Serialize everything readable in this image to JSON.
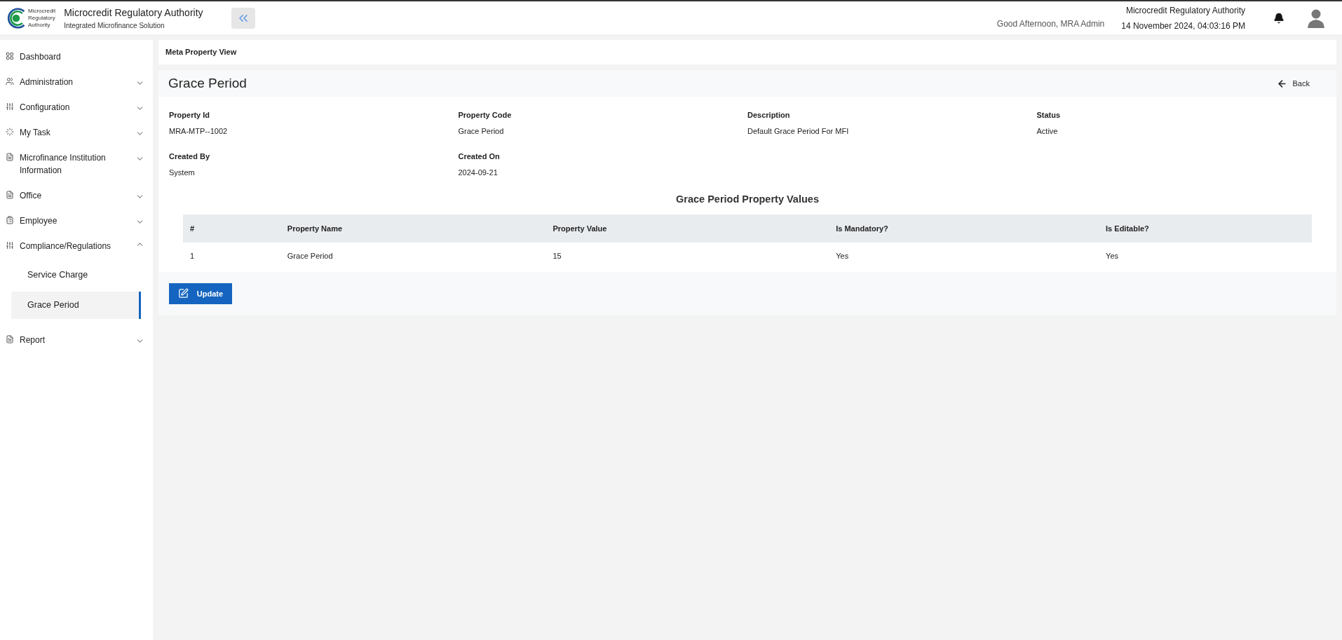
{
  "header": {
    "logo_text": [
      "Microcredit",
      "Regulatory",
      "Authority"
    ],
    "title": "Microcredit Regulatory Authority",
    "subtitle": "Integrated Microfinance Solution",
    "greeting": "Good Afternoon, MRA Admin",
    "org": "Microcredit Regulatory Authority",
    "datetime": "14 November 2024, 04:03:16 PM"
  },
  "sidebar": {
    "items": [
      {
        "kind": "link",
        "label": "Dashboard"
      },
      {
        "kind": "group",
        "label": "Administration",
        "expanded": false
      },
      {
        "kind": "group",
        "label": "Configuration",
        "expanded": false
      },
      {
        "kind": "group",
        "label": "My Task",
        "expanded": false
      },
      {
        "kind": "group",
        "label": "Microfinance Institution Information",
        "expanded": false
      },
      {
        "kind": "group",
        "label": "Office",
        "expanded": false
      },
      {
        "kind": "group",
        "label": "Employee",
        "expanded": false
      },
      {
        "kind": "group",
        "label": "Compliance/Regulations",
        "expanded": true,
        "children": [
          {
            "label": "Service Charge",
            "selected": false
          },
          {
            "label": "Grace Period",
            "selected": true
          }
        ]
      },
      {
        "kind": "group",
        "label": "Report",
        "expanded": false
      }
    ]
  },
  "breadcrumb": "Meta Property View",
  "page": {
    "title": "Grace Period",
    "back": "Back",
    "fields": [
      {
        "label": "Property Id",
        "value": "MRA-MTP--1002"
      },
      {
        "label": "Property Code",
        "value": "Grace Period"
      },
      {
        "label": "Description",
        "value": "Default Grace Period For MFI"
      },
      {
        "label": "Status",
        "value": "Active"
      },
      {
        "label": "Created By",
        "value": "System"
      },
      {
        "label": "Created On",
        "value": "2024-09-21"
      }
    ],
    "table": {
      "title": "Grace Period Property Values",
      "columns": [
        "#",
        "Property Name",
        "Property Value",
        "Is Mandatory?",
        "Is Editable?"
      ],
      "rows": [
        [
          "1",
          "Grace Period",
          "15",
          "Yes",
          "Yes"
        ]
      ]
    },
    "update_button": "Update"
  }
}
